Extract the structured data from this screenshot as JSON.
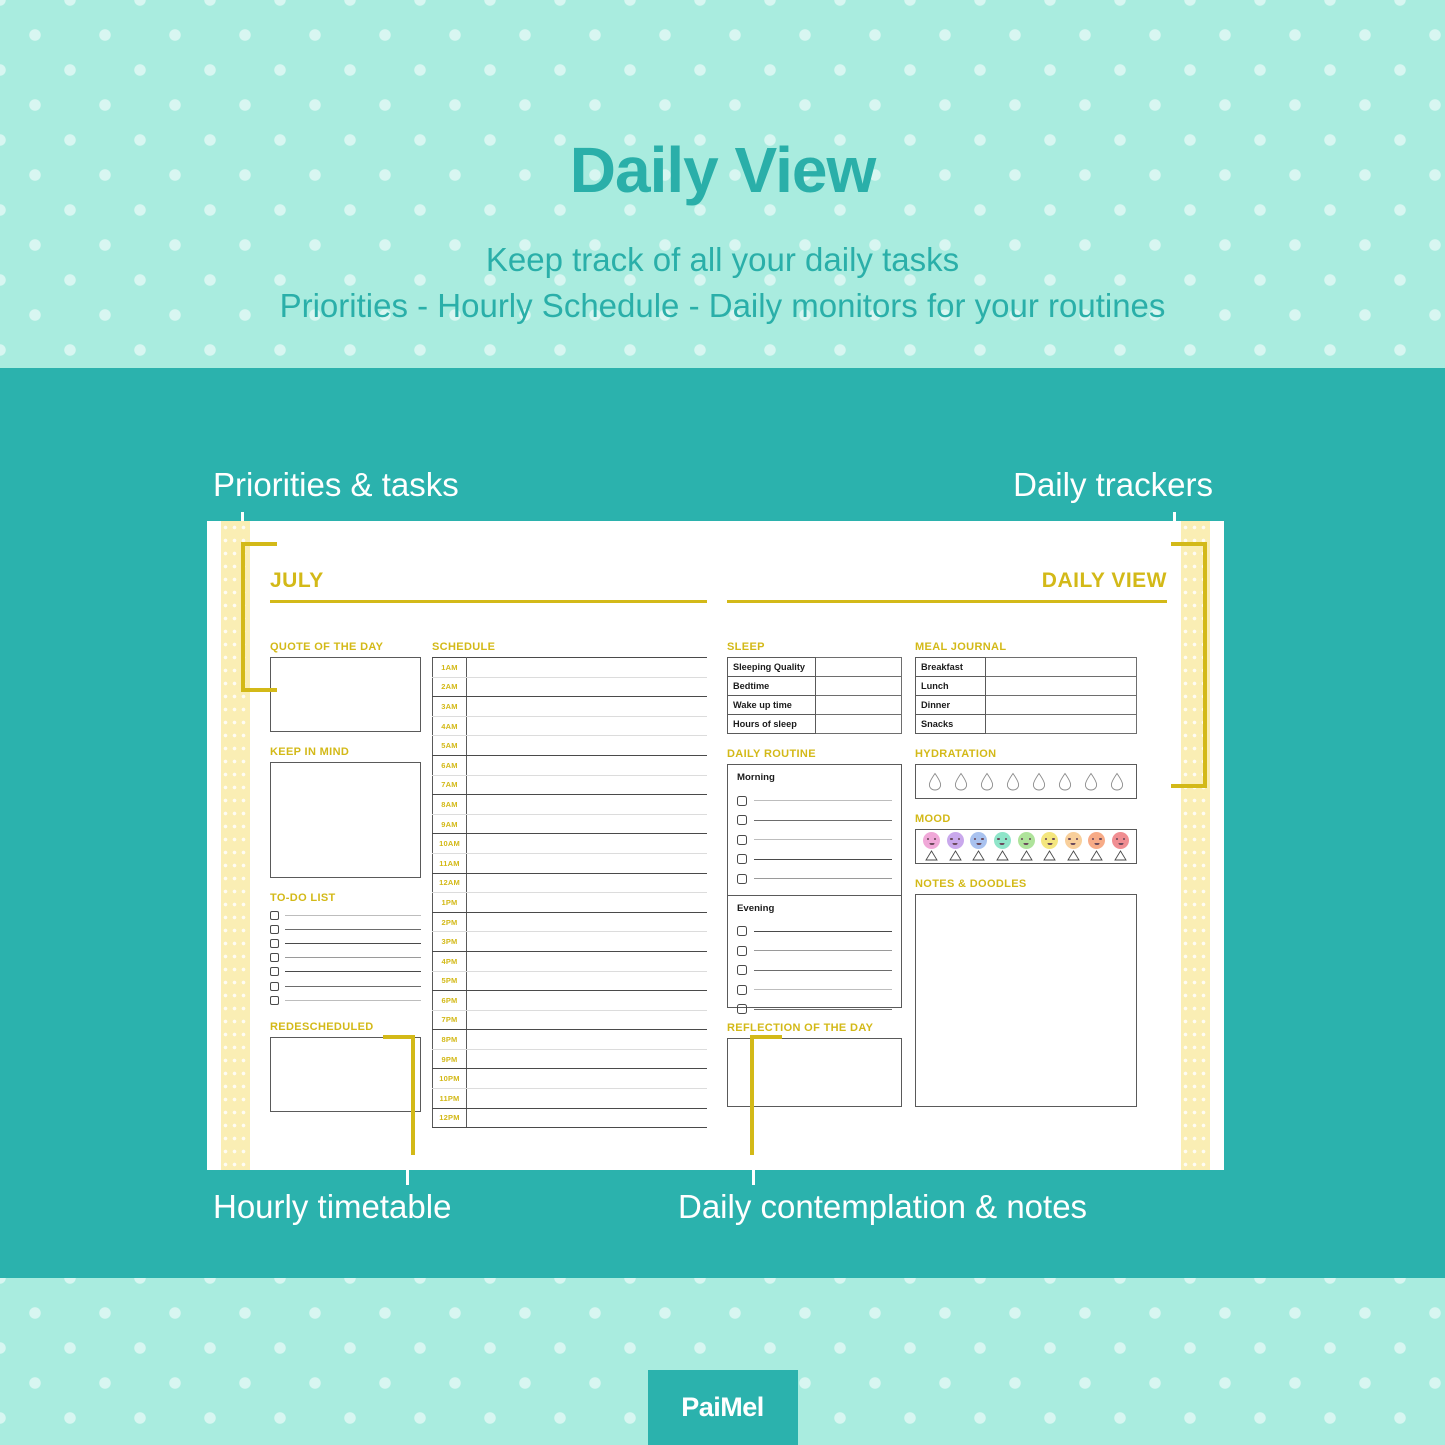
{
  "header": {
    "title": "Daily View",
    "subtitle_line1": "Keep track of all your daily tasks",
    "subtitle_line2": "Priorities - Hourly Schedule - Daily monitors for your routines"
  },
  "callouts": {
    "priorities": "Priorities & tasks",
    "trackers": "Daily trackers",
    "hourly": "Hourly timetable",
    "notes": "Daily contemplation & notes"
  },
  "left_page": {
    "month_title": "JULY",
    "quote_of_the_day": {
      "label": "QUOTE OF THE DAY",
      "value": ""
    },
    "keep_in_mind": {
      "label": "KEEP IN MIND",
      "value": ""
    },
    "todo_list": {
      "label": "TO-DO LIST",
      "rows": [
        "",
        "",
        "",
        "",
        "",
        "",
        ""
      ]
    },
    "redescheduled": {
      "label": "REDESCHEDULED",
      "value": ""
    },
    "schedule": {
      "label": "SCHEDULE",
      "hours": [
        "1AM",
        "2AM",
        "3AM",
        "4AM",
        "5AM",
        "6AM",
        "7AM",
        "8AM",
        "9AM",
        "10AM",
        "11AM",
        "12AM",
        "1PM",
        "2PM",
        "3PM",
        "4PM",
        "5PM",
        "6PM",
        "7PM",
        "8PM",
        "9PM",
        "10PM",
        "11PM",
        "12PM"
      ],
      "entries": [
        "",
        "",
        "",
        "",
        "",
        "",
        "",
        "",
        "",
        "",
        "",
        "",
        "",
        "",
        "",
        "",
        "",
        "",
        "",
        "",
        "",
        "",
        "",
        ""
      ]
    }
  },
  "right_page": {
    "title": "DAILY VIEW",
    "sleep": {
      "label": "SLEEP",
      "rows": [
        {
          "field": "Sleeping Quality",
          "value": ""
        },
        {
          "field": "Bedtime",
          "value": ""
        },
        {
          "field": "Wake up time",
          "value": ""
        },
        {
          "field": "Hours of sleep",
          "value": ""
        }
      ]
    },
    "meal_journal": {
      "label": "MEAL JOURNAL",
      "rows": [
        {
          "field": "Breakfast",
          "value": ""
        },
        {
          "field": "Lunch",
          "value": ""
        },
        {
          "field": "Dinner",
          "value": ""
        },
        {
          "field": "Snacks",
          "value": ""
        }
      ]
    },
    "daily_routine": {
      "label": "DAILY ROUTINE",
      "morning": {
        "title": "Morning",
        "rows": [
          "",
          "",
          "",
          "",
          ""
        ]
      },
      "evening": {
        "title": "Evening",
        "rows": [
          "",
          "",
          "",
          "",
          ""
        ]
      }
    },
    "hydratation": {
      "label": "HYDRATATION",
      "droplet_count": 8,
      "filled": 0
    },
    "mood": {
      "label": "MOOD",
      "faces": [
        {
          "name": "mood-1",
          "color": "#f0a8d8"
        },
        {
          "name": "mood-2",
          "color": "#c9a8ec"
        },
        {
          "name": "mood-3",
          "color": "#a9c2ef"
        },
        {
          "name": "mood-4",
          "color": "#8fe5c9"
        },
        {
          "name": "mood-5",
          "color": "#aee39b"
        },
        {
          "name": "mood-6",
          "color": "#f4e67f"
        },
        {
          "name": "mood-7",
          "color": "#f8cf9b"
        },
        {
          "name": "mood-8",
          "color": "#f7ab87"
        },
        {
          "name": "mood-9",
          "color": "#f08e92"
        }
      ]
    },
    "notes_doodles": {
      "label": "NOTES & DOODLES",
      "value": ""
    },
    "reflection": {
      "label": "REFLECTION OF THE DAY",
      "value": ""
    }
  },
  "footer": {
    "logo_text": "PaiMel"
  },
  "colors": {
    "mint_bg": "#a9ecdf",
    "teal": "#2bb2ad",
    "yellow": "#d3b918",
    "binding_yellow": "#faeeb4",
    "white": "#ffffff"
  }
}
